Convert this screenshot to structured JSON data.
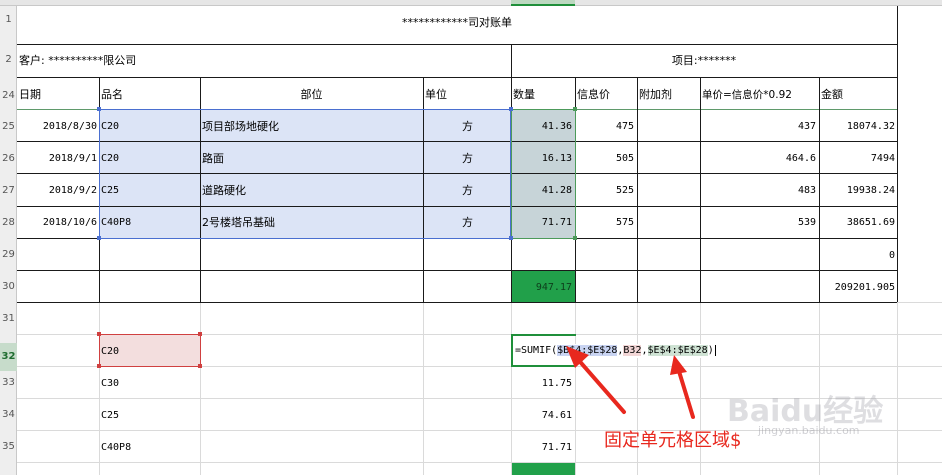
{
  "sheet": {
    "row_numbers": [
      "1",
      "2",
      "24",
      "25",
      "26",
      "27",
      "28",
      "29",
      "30",
      "31",
      "32",
      "33",
      "34",
      "35"
    ],
    "title": "************司对账单",
    "customer": "客户: **********限公司",
    "project": "项目:*******",
    "headers": [
      "日期",
      "品名",
      "部位",
      "单位",
      "数量",
      "信息价",
      "附加剂",
      "单价=信息价*0.92",
      "金额"
    ],
    "rows": [
      {
        "date": "2018/8/30",
        "product": "C20",
        "location": "项目部场地硬化",
        "unit": "方",
        "qty": "41.36",
        "price": "475",
        "additive": "",
        "unit_price": "437",
        "amount": "18074.32"
      },
      {
        "date": "2018/9/1",
        "product": "C20",
        "location": "路面",
        "unit": "方",
        "qty": "16.13",
        "price": "505",
        "additive": "",
        "unit_price": "464.6",
        "amount": "7494"
      },
      {
        "date": "2018/9/2",
        "product": "C25",
        "location": "道路硬化",
        "unit": "方",
        "qty": "41.28",
        "price": "525",
        "additive": "",
        "unit_price": "483",
        "amount": "19938.24"
      },
      {
        "date": "2018/10/6",
        "product": "C40P8",
        "location": "2号楼塔吊基础",
        "unit": "方",
        "qty": "71.71",
        "price": "575",
        "additive": "",
        "unit_price": "539",
        "amount": "38651.69"
      }
    ],
    "row29_amount": "0",
    "total_qty": "947.17",
    "total_amount": "209201.905",
    "summary": [
      {
        "product": "C20",
        "formula_prefix": "=SUMIF(",
        "tok1": "$B$4:$E$28",
        "sep1": ",",
        "tok2": "B32",
        "sep2": ",",
        "tok3": "$E$4:$E$28",
        "suffix": ")"
      },
      {
        "product": "C30",
        "value": "11.75"
      },
      {
        "product": "C25",
        "value": "74.61"
      },
      {
        "product": "C40P8",
        "value": "71.71"
      }
    ]
  },
  "annotation": "固定单元格区域$",
  "watermark": {
    "logo": "Baidu经验",
    "sub": "jingyan.baidu.com"
  },
  "colors": {
    "selection_blue": "#dce4f6",
    "green_fill": "#21a04a",
    "arrow_red": "#e8281e",
    "pink": "#f3dede"
  }
}
